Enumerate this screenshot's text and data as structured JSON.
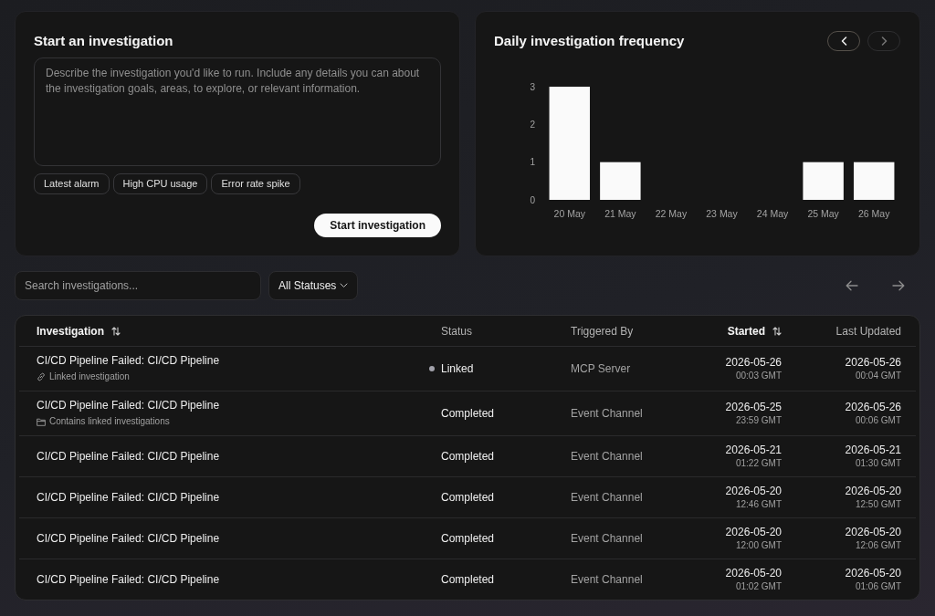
{
  "start_panel": {
    "title": "Start an investigation",
    "prompt": {
      "placeholder": "Describe the investigation you'd like to run. Include any details you can about the investigation goals, areas, to explore, or relevant information."
    },
    "suggestions": [
      "Latest alarm",
      "High CPU usage",
      "Error rate spike"
    ],
    "submit_button": "Start investigation"
  },
  "frequency_panel": {
    "title": "Daily investigation frequency",
    "nav": [
      {
        "disabled": false
      },
      {
        "disabled": true
      }
    ],
    "chart_data": {
      "type": "bar",
      "categories": [
        "20 May",
        "21 May",
        "22 May",
        "23 May",
        "24 May",
        "25 May",
        "26 May"
      ],
      "values": [
        3,
        1,
        0,
        0,
        0,
        1,
        1
      ],
      "ylim": [
        0,
        3
      ],
      "yticks": [
        0,
        1,
        2,
        3
      ]
    }
  },
  "filters": {
    "search": {
      "placeholder": "Search investigations..."
    },
    "status_filter": "All Statuses"
  },
  "table": {
    "columns": [
      {
        "label": "Investigation",
        "sortable": true
      },
      {
        "label": "Status",
        "sortable": false
      },
      {
        "label": "Triggered By",
        "sortable": false
      },
      {
        "label": "Started",
        "sortable": true
      },
      {
        "label": "Last Updated",
        "sortable": false
      }
    ],
    "rows": [
      {
        "title": "CI/CD Pipeline Failed: CI/CD Pipeline",
        "note": {
          "kind": "linked",
          "text": "Linked investigation"
        },
        "status": {
          "kind": "linked",
          "label": "Linked"
        },
        "triggered_by": "MCP Server",
        "started": {
          "date": "2026-05-26",
          "time": "00:03 GMT"
        },
        "last_updated": {
          "date": "2026-05-26",
          "time": "00:04 GMT"
        }
      },
      {
        "title": "CI/CD Pipeline Failed: CI/CD Pipeline",
        "note": {
          "kind": "contains_linked",
          "text": "Contains linked investigations"
        },
        "status": {
          "kind": "completed",
          "label": "Completed"
        },
        "triggered_by": "Event Channel",
        "started": {
          "date": "2026-05-25",
          "time": "23:59 GMT"
        },
        "last_updated": {
          "date": "2026-05-26",
          "time": "00:06 GMT"
        }
      },
      {
        "title": "CI/CD Pipeline Failed: CI/CD Pipeline",
        "status": {
          "kind": "completed",
          "label": "Completed"
        },
        "triggered_by": "Event Channel",
        "started": {
          "date": "2026-05-21",
          "time": "01:22 GMT"
        },
        "last_updated": {
          "date": "2026-05-21",
          "time": "01:30 GMT"
        }
      },
      {
        "title": "CI/CD Pipeline Failed: CI/CD Pipeline",
        "status": {
          "kind": "completed",
          "label": "Completed"
        },
        "triggered_by": "Event Channel",
        "started": {
          "date": "2026-05-20",
          "time": "12:46 GMT"
        },
        "last_updated": {
          "date": "2026-05-20",
          "time": "12:50 GMT"
        }
      },
      {
        "title": "CI/CD Pipeline Failed: CI/CD Pipeline",
        "status": {
          "kind": "completed",
          "label": "Completed"
        },
        "triggered_by": "Event Channel",
        "started": {
          "date": "2026-05-20",
          "time": "12:00 GMT"
        },
        "last_updated": {
          "date": "2026-05-20",
          "time": "12:06 GMT"
        }
      },
      {
        "title": "CI/CD Pipeline Failed: CI/CD Pipeline",
        "status": {
          "kind": "completed",
          "label": "Completed"
        },
        "triggered_by": "Event Channel",
        "started": {
          "date": "2026-05-20",
          "time": "01:02 GMT"
        },
        "last_updated": {
          "date": "2026-05-20",
          "time": "01:06 GMT"
        }
      }
    ]
  }
}
